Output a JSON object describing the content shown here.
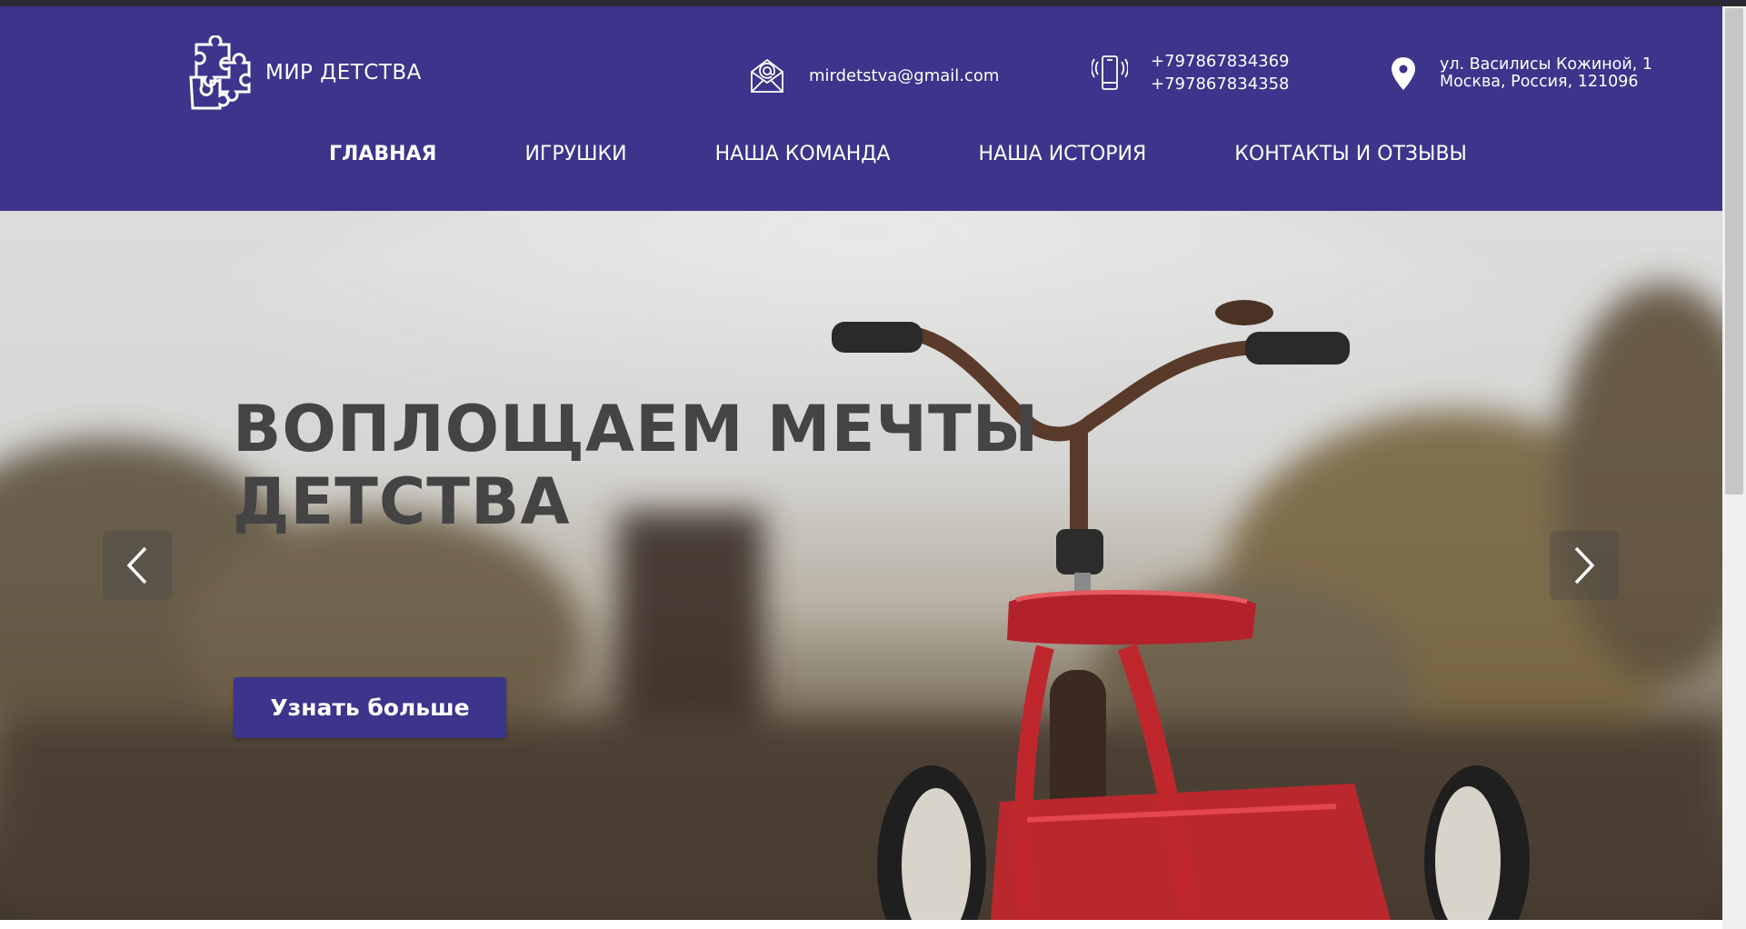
{
  "header": {
    "logo_text": "МИР ДЕТСТВА",
    "email": "mirdetstva@gmail.com",
    "phones": [
      "+797867834369",
      "+797867834358"
    ],
    "address": [
      "ул. Василисы Кожиной, 1",
      "Москва, Россия, 121096"
    ],
    "icons": {
      "logo": "puzzle-icon",
      "email": "envelope-icon",
      "phone": "phone-icon",
      "address": "map-pin-icon"
    }
  },
  "nav": {
    "items": [
      {
        "label": "ГЛАВНАЯ",
        "active": true
      },
      {
        "label": "ИГРУШКИ",
        "active": false
      },
      {
        "label": "НАША КОМАНДА",
        "active": false
      },
      {
        "label": "НАША ИСТОРИЯ",
        "active": false
      },
      {
        "label": "КОНТАКТЫ И ОТЗЫВЫ",
        "active": false
      }
    ]
  },
  "hero": {
    "title_line1": "ВОПЛОЩАЕМ МЕЧТЫ",
    "title_line2": "ДЕТСТВА",
    "cta_label": "Узнать больше",
    "image": "red-tricycle-photo"
  },
  "colors": {
    "brand": "#3d348b",
    "hero_title": "#444444",
    "tricycle": "#c0272d"
  }
}
